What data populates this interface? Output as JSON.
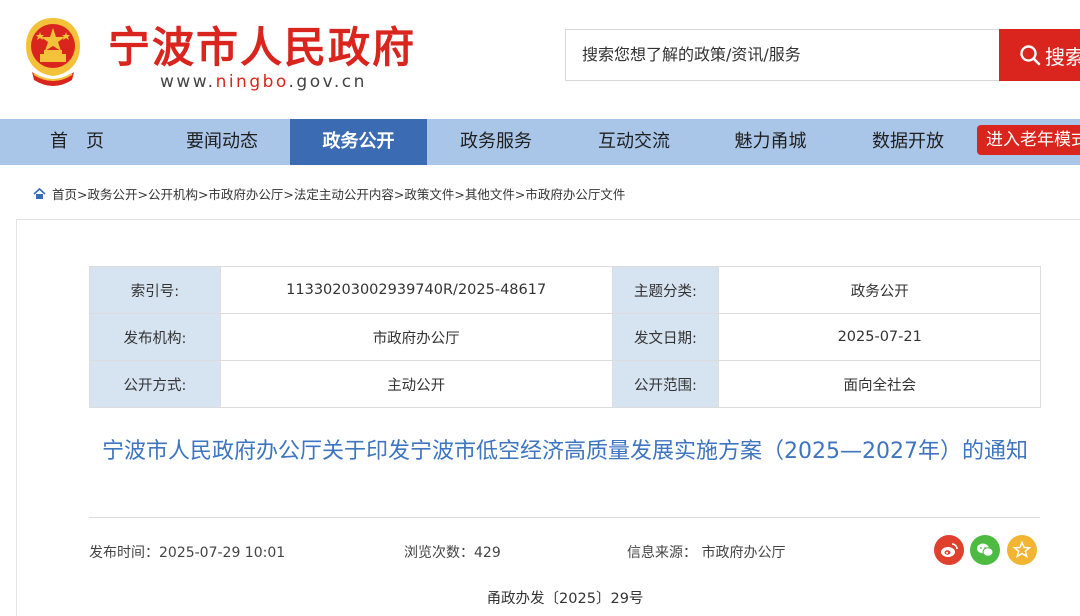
{
  "header": {
    "title": "宁波市人民政府",
    "url_prefix": "www.",
    "url_highlight": "ningbo",
    "url_suffix": ".gov.cn",
    "search_placeholder": "搜索您想了解的政策/资讯/服务",
    "search_button": "搜索"
  },
  "nav": {
    "items": [
      {
        "label": "首　页"
      },
      {
        "label": "要闻动态"
      },
      {
        "label": "政务公开"
      },
      {
        "label": "政务服务"
      },
      {
        "label": "互动交流"
      },
      {
        "label": "魅力甬城"
      },
      {
        "label": "数据开放"
      }
    ],
    "active_index": 2,
    "elder_mode": "进入老年模式"
  },
  "breadcrumb": {
    "text": "首页>政务公开>公开机构>市政府办公厅>法定主动公开内容>政策文件>其他文件>市政府办公厅文件"
  },
  "info": {
    "rows": [
      {
        "l1": "索引号:",
        "v1": "11330203002939740R/2025-48617",
        "l2": "主题分类:",
        "v2": "政务公开"
      },
      {
        "l1": "发布机构:",
        "v1": "市政府办公厅",
        "l2": "发文日期:",
        "v2": "2025-07-21"
      },
      {
        "l1": "公开方式:",
        "v1": "主动公开",
        "l2": "公开范围:",
        "v2": "面向全社会"
      }
    ]
  },
  "article": {
    "title": "宁波市人民政府办公厅关于印发宁波市低空经济高质量发展实施方案（2025—2027年）的通知",
    "publish_time": "发布时间：2025-07-29 10:01",
    "views": "浏览次数：429",
    "source": "信息来源：  市政府办公厅",
    "doc_number": "甬政办发〔2025〕29号"
  },
  "colors": {
    "brand_red": "#d9251d",
    "nav_bg": "#a9c6e8",
    "nav_active": "#3b6bb2",
    "title_blue": "#3d75c0",
    "label_bg": "#d6e3f1"
  },
  "share_icons": [
    "weibo-icon",
    "wechat-icon",
    "favorite-icon"
  ]
}
